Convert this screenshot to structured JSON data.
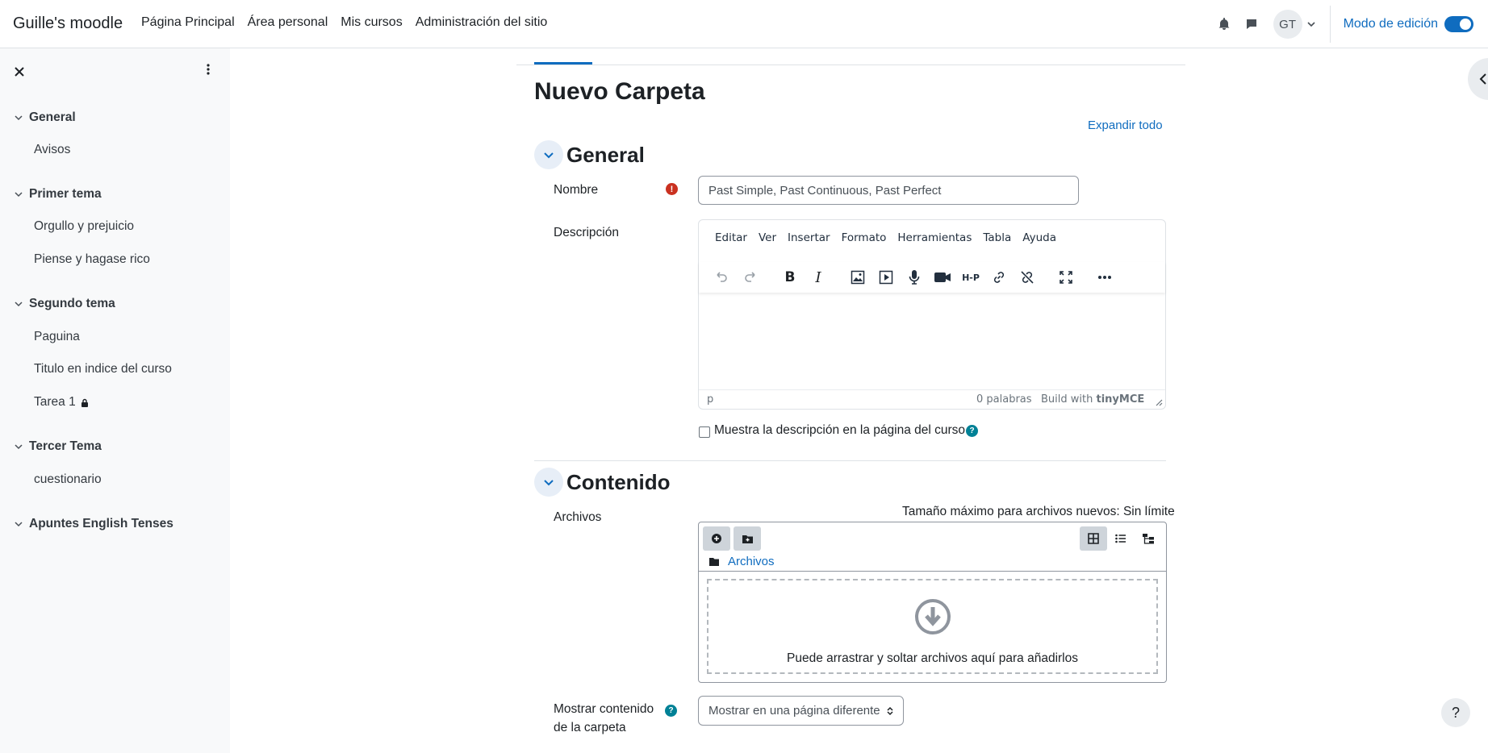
{
  "site_name": "Guille's moodle",
  "nav": {
    "links": [
      "Página Principal",
      "Área personal",
      "Mis cursos",
      "Administración del sitio"
    ],
    "avatar_initials": "GT",
    "edit_mode_label": "Modo de edición",
    "edit_mode_on": true
  },
  "drawer": {
    "sections": [
      {
        "title": "General",
        "items": [
          "Avisos"
        ]
      },
      {
        "title": "Primer tema",
        "items": [
          "Orgullo y prejuicio",
          "Piense y hagase rico"
        ]
      },
      {
        "title": "Segundo tema",
        "items": [
          "Paguina",
          "Titulo en indice del curso",
          "Tarea 1"
        ]
      },
      {
        "title": "Tercer Tema",
        "items": [
          "cuestionario"
        ]
      },
      {
        "title": "Apuntes English Tenses",
        "items": []
      }
    ]
  },
  "page": {
    "title": "Nuevo Carpeta",
    "expand_all": "Expandir todo"
  },
  "general": {
    "title": "General",
    "name_label": "Nombre",
    "name_value": "Past Simple, Past Continuous, Past Perfect",
    "description_label": "Descripción",
    "editor_menu": [
      "Editar",
      "Ver",
      "Insertar",
      "Formato",
      "Herramientas",
      "Tabla",
      "Ayuda"
    ],
    "status_path": "p",
    "status_words": "0 palabras",
    "status_build": "Build with",
    "status_brand": "tinyMCE",
    "show_description_label": "Muestra la descripción en la página del curso"
  },
  "content": {
    "title": "Contenido",
    "files_label": "Archivos",
    "max_size": "Tamaño máximo para archivos nuevos: Sin límite",
    "folder_path": "Archivos",
    "drop_text": "Puede arrastrar y soltar archivos aquí para añadirlos",
    "display_label_line1": "Mostrar contenido",
    "display_label_line2": "de la carpeta",
    "display_value": "Mostrar en una página diferente"
  },
  "colors": {
    "primary": "#0f6cbf",
    "required": "#ca3120",
    "help": "#008196"
  }
}
